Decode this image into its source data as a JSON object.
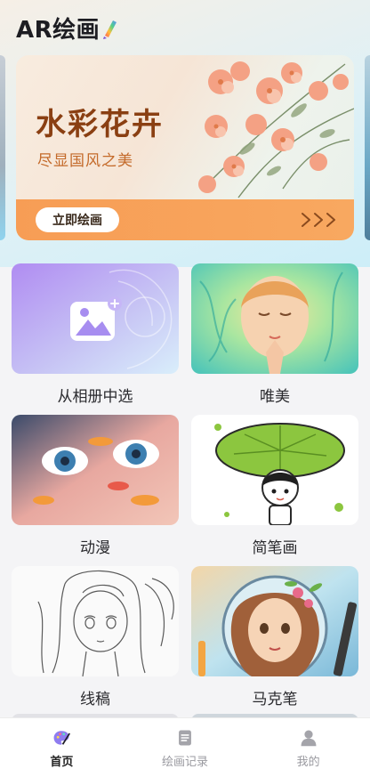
{
  "header": {
    "title": "AR绘画",
    "title_icon": "paintbrush-icon"
  },
  "banner": {
    "title": "水彩花卉",
    "subtitle": "尽显国风之美",
    "button_label": "立即绘画",
    "arrow_icon": "triple-chevron-right-icon",
    "accent": "#f79d55"
  },
  "grid": [
    {
      "label": "从相册中选",
      "icon": "photo-plus-icon"
    },
    {
      "label": "唯美"
    },
    {
      "label": "动漫"
    },
    {
      "label": "简笔画"
    },
    {
      "label": "线稿"
    },
    {
      "label": "马克笔"
    }
  ],
  "nav": [
    {
      "label": "首页",
      "icon": "palette-icon",
      "active": true
    },
    {
      "label": "绘画记录",
      "icon": "document-list-icon",
      "active": false
    },
    {
      "label": "我的",
      "icon": "user-icon",
      "active": false
    }
  ]
}
